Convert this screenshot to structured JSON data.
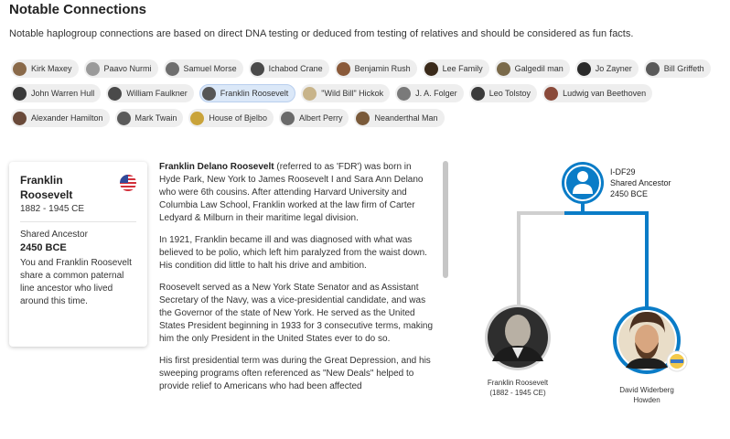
{
  "header": {
    "title": "Notable Connections",
    "intro": "Notable haplogroup connections are based on direct DNA testing or deduced from testing of relatives and should be considered as fun facts."
  },
  "chip_rows": [
    [
      {
        "label": "Kirk Maxey",
        "color": "#8a6a4a"
      },
      {
        "label": "Paavo Nurmi",
        "color": "#9a9a9a"
      },
      {
        "label": "Samuel Morse",
        "color": "#6e6e6e"
      },
      {
        "label": "Ichabod Crane",
        "color": "#4a4a4a"
      },
      {
        "label": "Benjamin Rush",
        "color": "#8a5a3a"
      },
      {
        "label": "Lee Family",
        "color": "#3a2a1a"
      },
      {
        "label": "Galgedil man",
        "color": "#7a6a4a"
      },
      {
        "label": "Jo Zayner",
        "color": "#2a2a2a"
      },
      {
        "label": "Bill Griffeth",
        "color": "#5a5a5a"
      }
    ],
    [
      {
        "label": "John Warren Hull",
        "color": "#3a3a3a"
      },
      {
        "label": "William Faulkner",
        "color": "#4a4a4a"
      },
      {
        "label": "Franklin Roosevelt",
        "color": "#555555",
        "active": true
      },
      {
        "label": "\"Wild Bill\" Hickok",
        "color": "#c8b48a"
      },
      {
        "label": "J. A. Folger",
        "color": "#7a7a7a"
      },
      {
        "label": "Leo Tolstoy",
        "color": "#3a3a3a"
      },
      {
        "label": "Ludwig van Beethoven",
        "color": "#8a4a3a"
      }
    ],
    [
      {
        "label": "Alexander Hamilton",
        "color": "#6a4a3a"
      },
      {
        "label": "Mark Twain",
        "color": "#5a5a5a"
      },
      {
        "label": "House of Bjelbo",
        "color": "#c9a33a"
      },
      {
        "label": "Albert Perry",
        "color": "#6a6a6a"
      },
      {
        "label": "Neanderthal Man",
        "color": "#7a5a3a"
      }
    ]
  ],
  "card": {
    "name": "Franklin Roosevelt",
    "years": "1882 - 1945 CE",
    "shared_label": "Shared Ancestor",
    "shared_value": "2450 BCE",
    "description": "You and Franklin Roosevelt share a common paternal line ancestor who lived around this time.",
    "flag_icon": "us-flag-icon"
  },
  "article": {
    "p1_bold": "Franklin Delano Roosevelt",
    "p1_rest": " (referred to as 'FDR') was born in Hyde Park, New York to James Roosevelt I and Sara Ann Delano who were 6th cousins. After attending Harvard University and Columbia Law School, Franklin worked at the law firm of Carter Ledyard & Milburn in their maritime legal division.",
    "p2": "In 1921, Franklin became ill and was diagnosed with what was believed to be polio, which left him paralyzed from the waist down. His condition did little to halt his drive and ambition.",
    "p3": "Roosevelt served as a New York State Senator and as Assistant Secretary of the Navy, was a vice-presidential candidate, and was the Governor of the state of New York. He served as the United States President beginning in 1933 for 3 consecutive terms, making him the only President in the United States ever to do so.",
    "p4": "His first presidential term was during the Great Depression, and his sweeping programs often referenced as \"New Deals\" helped to provide relief to Americans who had been affected"
  },
  "tree": {
    "ancestor_haplogroup": "I-DF29",
    "ancestor_label": "Shared Ancestor",
    "ancestor_date": "2450 BCE",
    "left_name": "Franklin Roosevelt",
    "left_years": "(1882 - 1945 CE)",
    "right_name_1": "David Widerberg",
    "right_name_2": "Howden",
    "colors": {
      "accent": "#0a7cc7",
      "grey_line": "#cfcfcf"
    }
  }
}
